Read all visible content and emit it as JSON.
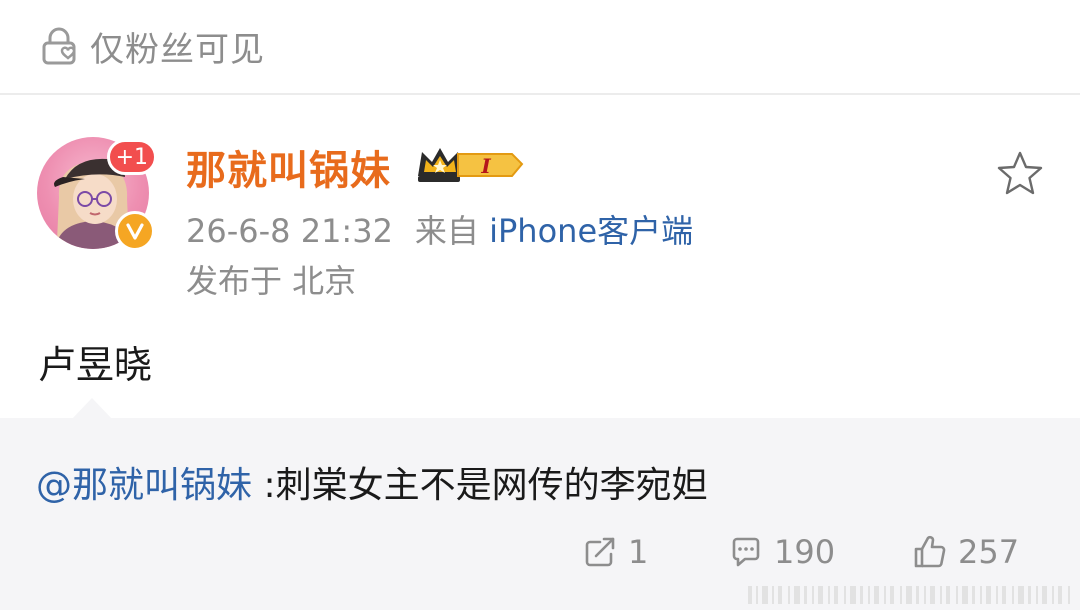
{
  "visibility": {
    "label": "仅粉丝可见"
  },
  "author": {
    "name": "那就叫锅妹",
    "new_count_badge": "+1",
    "level_badge_letter": "I",
    "name_color": "#e86b1c"
  },
  "meta": {
    "timestamp": "26-6-8 21:32",
    "source_prefix": "来自",
    "source_app": "iPhone客户端",
    "location": "发布于 北京"
  },
  "post": {
    "text": "卢昱晓"
  },
  "quote": {
    "mention": "@那就叫锅妹",
    "text": " :刺棠女主不是网传的李宛妲"
  },
  "actions": {
    "share_count": "1",
    "comment_count": "190",
    "like_count": "257"
  },
  "icons": {
    "visibility": "lock-heart-icon",
    "favorite": "star-outline-icon",
    "share": "share-icon",
    "comment": "comment-icon",
    "like": "thumbs-up-icon",
    "verified": "verified-v-icon",
    "level": "crown-icon"
  },
  "colors": {
    "link_blue": "#2f63a8",
    "muted_gray": "#8d8d8d",
    "badge_red": "#f24e4e",
    "verified_orange": "#f5a623"
  }
}
